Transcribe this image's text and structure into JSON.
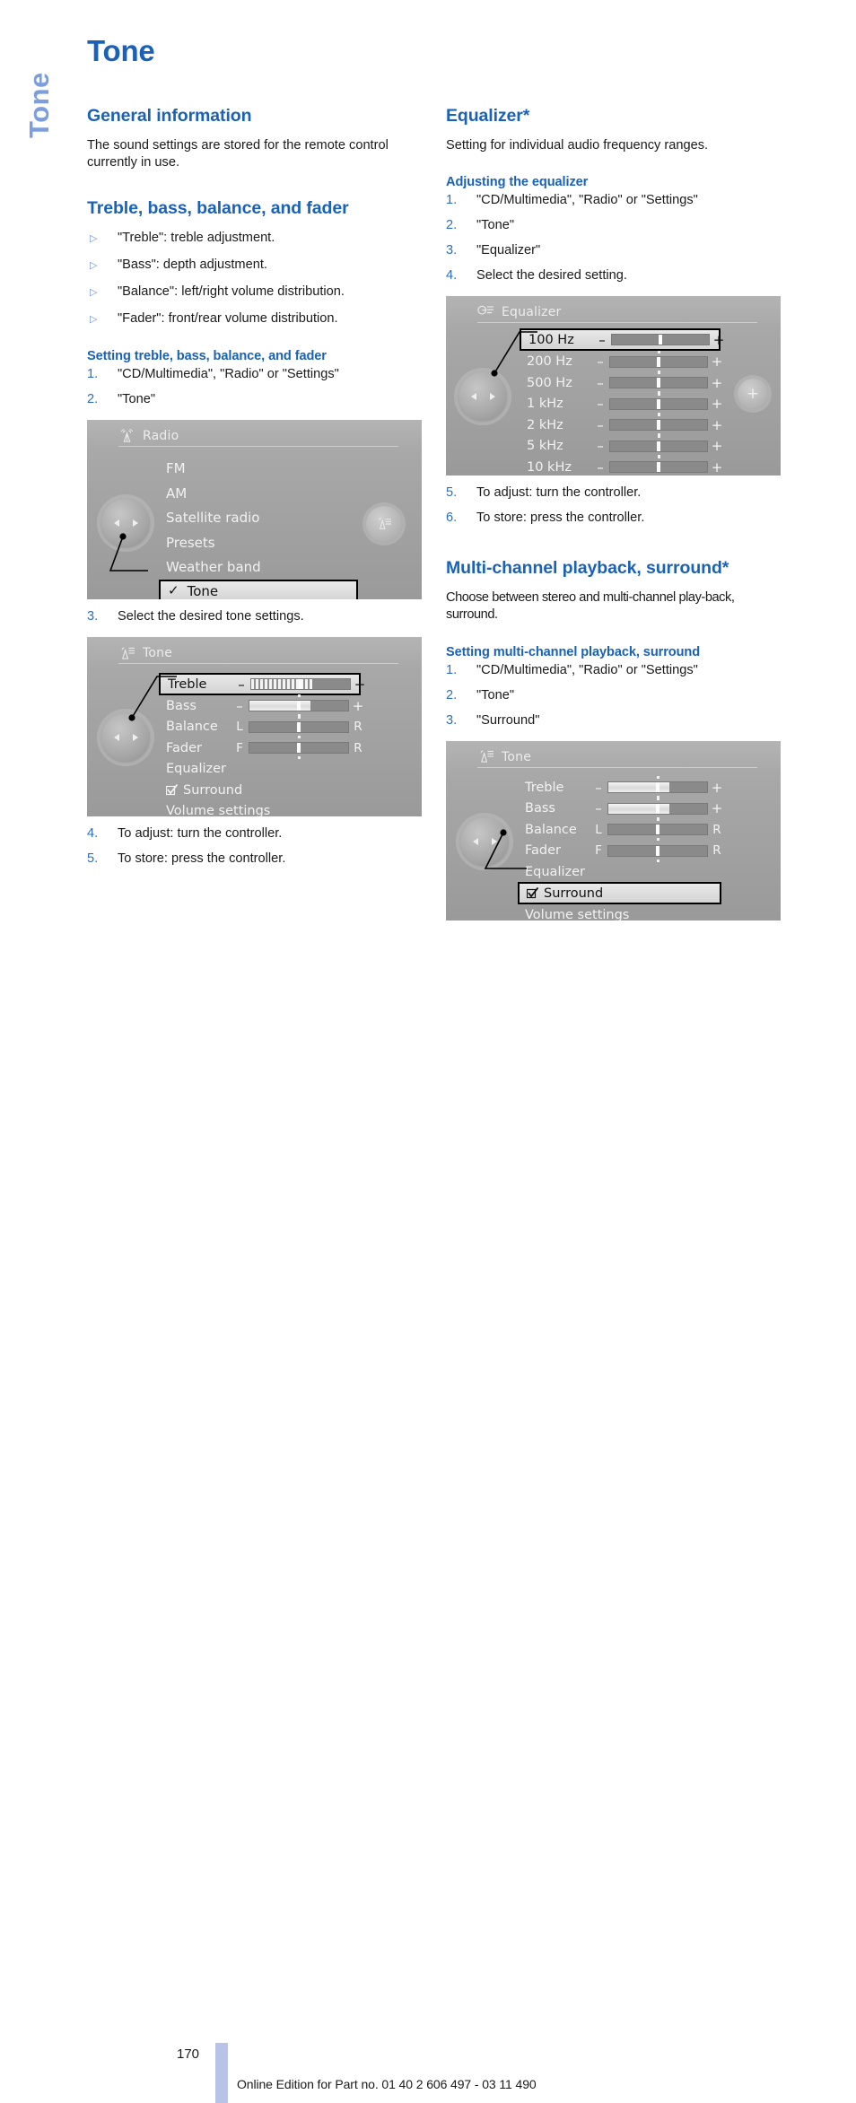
{
  "chapter_tab": "Tone",
  "page_title": "Tone",
  "accent_blue": "#1a62b8",
  "tab_blue": "#7d9ede",
  "left": {
    "s1_heading": "General information",
    "s1_body": "The sound settings are stored for the remote control currently in use.",
    "s2_heading": "Treble, bass, balance, and fader",
    "s2_bullets": [
      "\"Treble\": treble adjustment.",
      "\"Bass\": depth adjustment.",
      "\"Balance\": left/right volume distribution.",
      "\"Fader\": front/rear volume distribution."
    ],
    "s2_sub": "Setting treble, bass, balance, and fader",
    "s2_steps_a": [
      {
        "num": "1.",
        "text": "\"CD/Multimedia\", \"Radio\" or \"Settings\""
      },
      {
        "num": "2.",
        "text": "\"Tone\""
      }
    ],
    "s2_steps_b": [
      {
        "num": "3.",
        "text": "Select the desired tone settings."
      }
    ],
    "s2_steps_c": [
      {
        "num": "4.",
        "text": "To adjust: turn the controller."
      },
      {
        "num": "5.",
        "text": "To store: press the controller."
      }
    ]
  },
  "right": {
    "s3_heading": "Equalizer*",
    "s3_body": "Setting for individual audio frequency ranges.",
    "s3_sub": "Adjusting the equalizer",
    "s3_steps_a": [
      {
        "num": "1.",
        "text": "\"CD/Multimedia\", \"Radio\" or \"Settings\""
      },
      {
        "num": "2.",
        "text": "\"Tone\""
      },
      {
        "num": "3.",
        "text": "\"Equalizer\""
      },
      {
        "num": "4.",
        "text": "Select the desired setting."
      }
    ],
    "s3_steps_b": [
      {
        "num": "5.",
        "text": "To adjust: turn the controller."
      },
      {
        "num": "6.",
        "text": "To store: press the controller."
      }
    ],
    "s4_heading": "Multi-channel playback, surround*",
    "s4_body": "Choose between stereo and multi-channel play-back, surround.",
    "s4_sub": "Setting multi-channel playback, surround",
    "s4_steps_a": [
      {
        "num": "1.",
        "text": "\"CD/Multimedia\", \"Radio\" or \"Settings\""
      },
      {
        "num": "2.",
        "text": "\"Tone\""
      },
      {
        "num": "3.",
        "text": "\"Surround\""
      }
    ]
  },
  "screens": {
    "radio": {
      "title": "Radio",
      "icon": "radio-antenna-icon",
      "items": [
        {
          "label": "FM",
          "selected": false,
          "check": false
        },
        {
          "label": "AM",
          "selected": false,
          "check": false
        },
        {
          "label": "Satellite radio",
          "selected": false,
          "check": false
        },
        {
          "label": "Presets",
          "selected": false,
          "check": false
        },
        {
          "label": "Weather band",
          "selected": false,
          "check": false
        },
        {
          "label": "Tone",
          "selected": true,
          "check": true
        }
      ],
      "right_button": "radio-tuner-icon"
    },
    "tone_treble": {
      "title": "Tone",
      "icon": "tone-icon",
      "rows": [
        {
          "label": "Treble",
          "type": "pm",
          "minus": "–",
          "plus": "+",
          "fill": 62,
          "striped": true,
          "selected": true
        },
        {
          "label": "Bass",
          "type": "pm",
          "minus": "–",
          "plus": "+",
          "fill": 62,
          "striped": false,
          "selected": false
        },
        {
          "label": "Balance",
          "type": "lr",
          "left": "L",
          "right": "R",
          "selected": false
        },
        {
          "label": "Fader",
          "type": "lr",
          "left": "F",
          "right": "R",
          "selected": false
        },
        {
          "label": "Equalizer",
          "type": "plain",
          "selected": false
        },
        {
          "label": "Surround",
          "type": "check",
          "selected": false
        },
        {
          "label": "Volume settings",
          "type": "plain",
          "selected": false
        }
      ]
    },
    "equalizer": {
      "title": "Equalizer",
      "icon": "equalizer-icon",
      "rows": [
        {
          "label": "100 Hz",
          "minus": "–",
          "plus": "+",
          "selected": true
        },
        {
          "label": "200 Hz",
          "minus": "–",
          "plus": "+",
          "selected": false
        },
        {
          "label": "500 Hz",
          "minus": "–",
          "plus": "+",
          "selected": false
        },
        {
          "label": "1 kHz",
          "minus": "–",
          "plus": "+",
          "selected": false
        },
        {
          "label": "2 kHz",
          "minus": "–",
          "plus": "+",
          "selected": false
        },
        {
          "label": "5 kHz",
          "minus": "–",
          "plus": "+",
          "selected": false
        },
        {
          "label": "10 kHz",
          "minus": "–",
          "plus": "+",
          "selected": false
        }
      ],
      "right_button": "plus-icon"
    },
    "tone_surround": {
      "title": "Tone",
      "icon": "tone-icon",
      "rows": [
        {
          "label": "Treble",
          "type": "pm",
          "minus": "–",
          "plus": "+",
          "fill": 62,
          "striped": false,
          "selected": false
        },
        {
          "label": "Bass",
          "type": "pm",
          "minus": "–",
          "plus": "+",
          "fill": 62,
          "striped": false,
          "selected": false
        },
        {
          "label": "Balance",
          "type": "lr",
          "left": "L",
          "right": "R",
          "selected": false
        },
        {
          "label": "Fader",
          "type": "lr",
          "left": "F",
          "right": "R",
          "selected": false
        },
        {
          "label": "Equalizer",
          "type": "plain",
          "selected": false
        },
        {
          "label": "Surround",
          "type": "check",
          "selected": true
        },
        {
          "label": "Volume settings",
          "type": "plain",
          "selected": false
        }
      ]
    }
  },
  "footer": {
    "page_number": "170",
    "note": "Online Edition for Part no. 01 40 2 606 497 - 03 11 490"
  }
}
